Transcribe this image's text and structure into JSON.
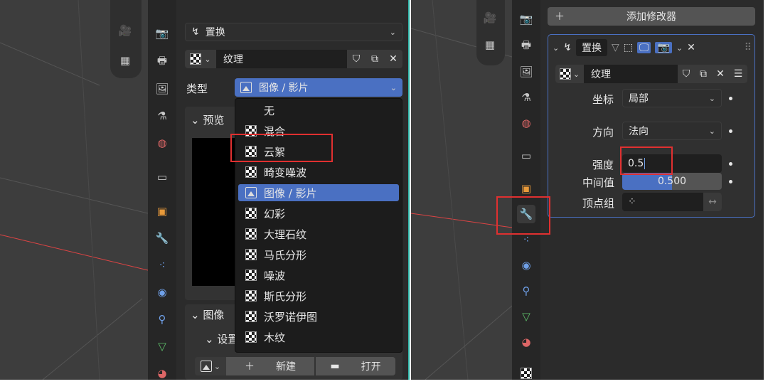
{
  "left": {
    "modifier_type_label": "置换",
    "texture_name": "纹理",
    "type_label": "类型",
    "type_value": "图像 / 影片",
    "preview_header": "预览",
    "image_header": "图像",
    "settings_header": "设置",
    "new_label": "新建",
    "open_label": "打开",
    "menu_items": [
      "无",
      "混合",
      "云絮",
      "畸变噪波",
      "图像 / 影片",
      "幻彩",
      "大理石纹",
      "马氏分形",
      "噪波",
      "斯氏分形",
      "沃罗诺伊图",
      "木纹"
    ]
  },
  "right": {
    "add_modifier": "添加修改器",
    "modifier_name": "置换",
    "texture_name": "纹理",
    "coords_label": "坐标",
    "coords_value": "局部",
    "direction_label": "方向",
    "direction_value": "法向",
    "strength_label": "强度",
    "strength_value": "0.5",
    "midlevel_label": "中间值",
    "midlevel_value": "0.500",
    "vertex_group_label": "顶点组"
  },
  "colors": {
    "accent": "#4a70c2",
    "highlight": "#e03030",
    "divider": "#2fb5a8"
  }
}
